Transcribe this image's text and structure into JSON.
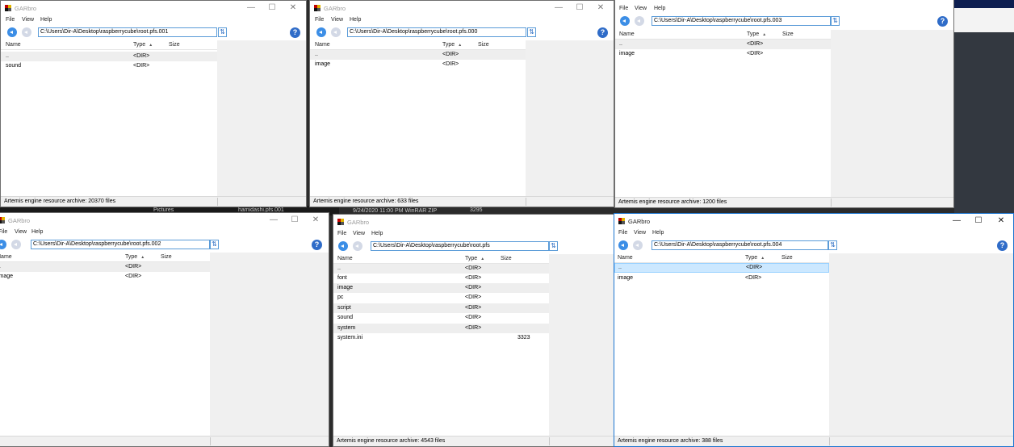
{
  "app": {
    "title": "GARbro",
    "menu": [
      "File",
      "View",
      "Help"
    ],
    "columns": {
      "name": "Name",
      "type": "Type",
      "size": "Size"
    },
    "colors": {
      "accent": "#1c75d0",
      "selection": "#cce8ff",
      "nav_back": "#3c8ee6",
      "help": "#2f6cc8"
    }
  },
  "desktop": {
    "explorer_items": [
      "Pictures",
      "hamidashi.pfs.001"
    ],
    "explorer_detail": "9/24/2020 11:00 PM    WinRAR ZIP",
    "explorer_size": "3295"
  },
  "windows": [
    {
      "id": "w001",
      "title": "GARbro",
      "path": "C:\\Users\\Dir-A\\Desktop\\raspberrycube\\root.pfs.001",
      "status": "Artemis engine resource archive: 20370 files",
      "rows": [
        {
          "name": "..",
          "type": "<DIR>",
          "size": ""
        },
        {
          "name": "sound",
          "type": "<DIR>",
          "size": ""
        }
      ]
    },
    {
      "id": "w000",
      "title": "GARbro",
      "path": "C:\\Users\\Dir-A\\Desktop\\raspberrycube\\root.pfs.000",
      "status": "Artemis engine resource archive: 633 files",
      "rows": [
        {
          "name": "..",
          "type": "<DIR>",
          "size": ""
        },
        {
          "name": "image",
          "type": "<DIR>",
          "size": ""
        }
      ]
    },
    {
      "id": "w003",
      "title": "GARbro",
      "path": "C:\\Users\\Dir-A\\Desktop\\raspberrycube\\root.pfs.003",
      "status": "Artemis engine resource archive: 1200 files",
      "rows": [
        {
          "name": "..",
          "type": "<DIR>",
          "size": ""
        },
        {
          "name": "image",
          "type": "<DIR>",
          "size": ""
        }
      ]
    },
    {
      "id": "w002",
      "title": "GARbro",
      "path": "C:\\Users\\Dir-A\\Desktop\\raspberrycube\\root.pfs.002",
      "status": "",
      "rows": [
        {
          "name": "..",
          "type": "<DIR>",
          "size": ""
        },
        {
          "name": "image",
          "type": "<DIR>",
          "size": ""
        }
      ]
    },
    {
      "id": "wroot",
      "title": "GARbro",
      "path": "C:\\Users\\Dir-A\\Desktop\\raspberrycube\\root.pfs",
      "status": "Artemis engine resource archive: 4543 files",
      "rows": [
        {
          "name": "..",
          "type": "<DIR>",
          "size": ""
        },
        {
          "name": "font",
          "type": "<DIR>",
          "size": ""
        },
        {
          "name": "image",
          "type": "<DIR>",
          "size": ""
        },
        {
          "name": "pc",
          "type": "<DIR>",
          "size": ""
        },
        {
          "name": "script",
          "type": "<DIR>",
          "size": ""
        },
        {
          "name": "sound",
          "type": "<DIR>",
          "size": ""
        },
        {
          "name": "system",
          "type": "<DIR>",
          "size": ""
        },
        {
          "name": "system.ini",
          "type": "",
          "size": "3323"
        }
      ]
    },
    {
      "id": "w004",
      "title": "GARbro",
      "path": "C:\\Users\\Dir-A\\Desktop\\raspberrycube\\root.pfs.004",
      "status": "Artemis engine resource archive: 388 files",
      "rows": [
        {
          "name": "..",
          "type": "<DIR>",
          "size": ""
        },
        {
          "name": "image",
          "type": "<DIR>",
          "size": ""
        }
      ]
    }
  ]
}
